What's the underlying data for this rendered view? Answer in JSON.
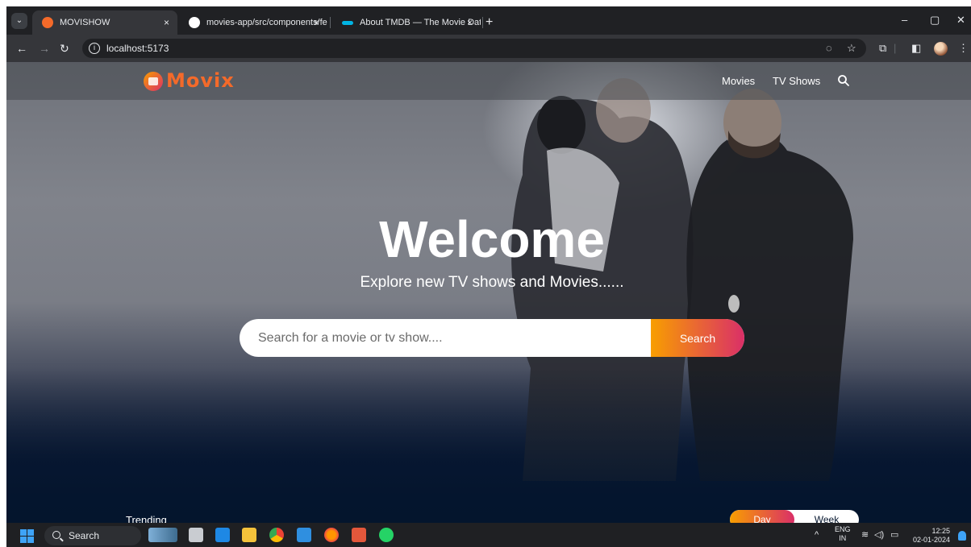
{
  "browser": {
    "tabs": [
      {
        "title": "MOVISHOW",
        "active": true,
        "favicon": "movix-favicon",
        "favicon_color": "#f46a2a"
      },
      {
        "title": "movies-app/src/components/fe",
        "active": false,
        "favicon": "github-icon",
        "favicon_color": "#ffffff"
      },
      {
        "title": "About TMDB — The Movie Dat",
        "active": false,
        "favicon": "tmdb-icon",
        "favicon_color": "#01b4e4"
      }
    ],
    "tab_close": "×",
    "new_tab": "+",
    "url": "localhost:5173"
  },
  "site": {
    "logo_text": "Movix",
    "nav": {
      "movies": "Movies",
      "tv_shows": "TV Shows"
    },
    "hero_title": "Welcome",
    "hero_subtitle": "Explore new TV shows and Movies......",
    "search_placeholder": "Search for a movie or tv show....",
    "search_button": "Search",
    "trending_label": "Trending",
    "switch": {
      "day": "Day",
      "week": "Week",
      "selected": "Day"
    }
  },
  "taskbar": {
    "search_label": "Search",
    "lang_top": "ENG",
    "lang_bottom": "IN",
    "time": "12:25",
    "date": "02-01-2024"
  },
  "colors": {
    "accent_start": "#f89e00",
    "accent_end": "#da2f68",
    "page_bg": "#04152d"
  }
}
